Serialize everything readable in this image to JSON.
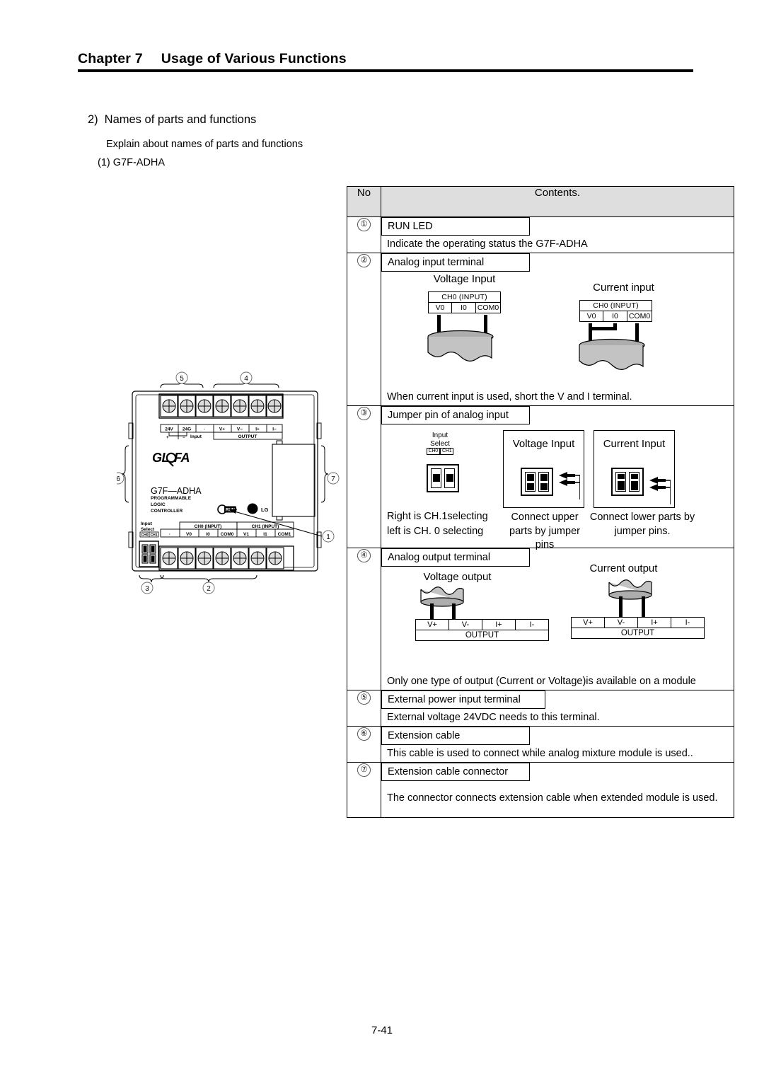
{
  "header": {
    "chapter_no": "Chapter 7",
    "chapter_title": "Usage of Various Functions"
  },
  "intro": {
    "section_no": "2)",
    "section_title": "Names of parts and functions",
    "explain": "Explain about names of parts and functions",
    "model_item": "(1) G7F-ADHA"
  },
  "table": {
    "headers": {
      "no": "No",
      "contents": "Contents."
    },
    "rows": [
      {
        "no": "①",
        "title": "RUN LED",
        "desc": "Indicate the operating status the G7F-ADHA"
      },
      {
        "no": "②",
        "title": "Analog input terminal",
        "caption_left": "Voltage Input",
        "caption_right": "Current input",
        "terminal_header": "CH0 (INPUT)",
        "terminal_cells": [
          "V0",
          "I0",
          "COM0"
        ],
        "desc": "When current input is used, short the V and I terminal."
      },
      {
        "no": "③",
        "title": "Jumper pin of analog input",
        "select_label_1": "Input",
        "select_label_2": "Select",
        "select_ch0": "CH0",
        "select_ch1": "CH1",
        "box_voltage": "Voltage Input",
        "box_current": "Current Input",
        "desc_left_1": "Right is CH.1selecting",
        "desc_left_2": "left is CH. 0 selecting",
        "desc_mid_1": "Connect upper",
        "desc_mid_2": "parts by jumper",
        "desc_mid_3": "pins",
        "desc_right_1": "Connect lower parts by",
        "desc_right_2": "jumper pins."
      },
      {
        "no": "④",
        "title": "Analog output terminal",
        "caption_left": "Voltage output",
        "caption_right": "Current output",
        "output_cells": [
          "V+",
          "V-",
          "I+",
          "I-"
        ],
        "output_label": "OUTPUT",
        "desc": "Only one type of output (Current or Voltage)is available on a module"
      },
      {
        "no": "⑤",
        "title": "External power input terminal",
        "desc": "External voltage 24VDC needs to this terminal."
      },
      {
        "no": "⑥",
        "title": "Extension cable",
        "desc": "This cable is used to connect while analog mixture module is used.."
      },
      {
        "no": "⑦",
        "title": "Extension cable connector",
        "desc": "The  connector  connects  extension  cable  when  extended  module  is  used."
      }
    ]
  },
  "module": {
    "brand": "GLOFA",
    "model": "G7F—ADHA",
    "sub_1": "PROGRAMMABLE",
    "sub_2": "LOGIC",
    "sub_3": "CONTROLLER",
    "led_label": "RUN",
    "vendor": "LG",
    "top_terminals": [
      "24V",
      "24G",
      "·",
      "V+",
      "V−",
      "I+",
      "I−"
    ],
    "top_group_left": "Input",
    "top_group_right": "OUTPUT",
    "bottom_terminals": [
      "·",
      "V0",
      "I0",
      "COM0",
      "V1",
      "I1",
      "COM1"
    ],
    "bottom_group_left": "CH0 (INPUT)",
    "bottom_group_right": "CH1 (INPUT)",
    "input_select_1": "Input",
    "input_select_2": "Select",
    "input_select_ch0": "CH0",
    "input_select_ch1": "CH1",
    "callouts": {
      "top_left": "⑤",
      "top_right": "④",
      "left": "⑥",
      "right": "⑦",
      "led": "①",
      "bottom_left": "③",
      "bottom_mid": "②"
    }
  },
  "footer": {
    "page": "7-41"
  }
}
